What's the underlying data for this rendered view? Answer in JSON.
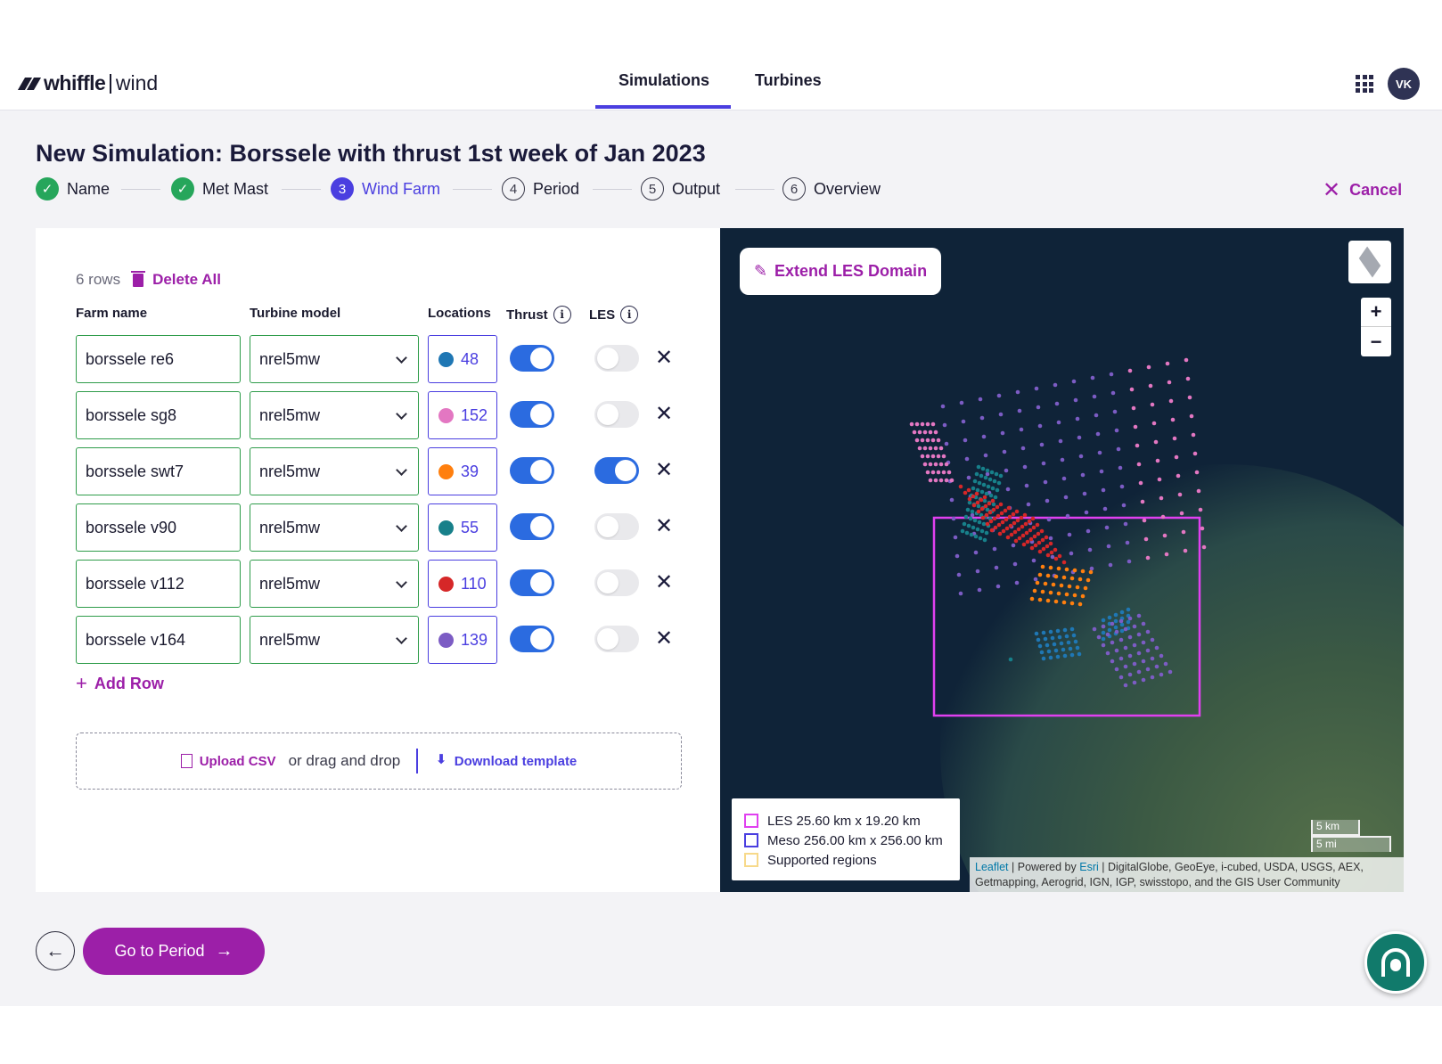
{
  "header": {
    "brand": "whiffle",
    "brand_sub": "wind",
    "tabs": [
      {
        "label": "Simulations",
        "active": true
      },
      {
        "label": "Turbines",
        "active": false
      }
    ],
    "apps_icon": "apps-grid-icon",
    "avatar_initials": "VK"
  },
  "page_title": "New Simulation: Borssele with thrust 1st week of Jan 2023",
  "stepper": [
    {
      "num": "✓",
      "label": "Name",
      "state": "done"
    },
    {
      "num": "✓",
      "label": "Met Mast",
      "state": "done"
    },
    {
      "num": "3",
      "label": "Wind Farm",
      "state": "current"
    },
    {
      "num": "4",
      "label": "Period",
      "state": "todo"
    },
    {
      "num": "5",
      "label": "Output",
      "state": "todo"
    },
    {
      "num": "6",
      "label": "Overview",
      "state": "todo"
    }
  ],
  "cancel_label": "Cancel",
  "table": {
    "row_count": "6 rows",
    "delete_all": "Delete All",
    "columns": {
      "farm": "Farm name",
      "model": "Turbine model",
      "locations": "Locations",
      "thrust": "Thrust",
      "les": "LES"
    },
    "rows": [
      {
        "name": "borssele re6",
        "model": "nrel5mw",
        "locations": "48",
        "color": "#1f77b4",
        "thrust": true,
        "les": false
      },
      {
        "name": "borssele sg8",
        "model": "nrel5mw",
        "locations": "152",
        "color": "#e377c2",
        "thrust": true,
        "les": false
      },
      {
        "name": "borssele swt7",
        "model": "nrel5mw",
        "locations": "39",
        "color": "#ff7f0e",
        "thrust": true,
        "les": true
      },
      {
        "name": "borssele v90",
        "model": "nrel5mw",
        "locations": "55",
        "color": "#17808a",
        "thrust": true,
        "les": false
      },
      {
        "name": "borssele v112",
        "model": "nrel5mw",
        "locations": "110",
        "color": "#d62728",
        "thrust": true,
        "les": false
      },
      {
        "name": "borssele v164",
        "model": "nrel5mw",
        "locations": "139",
        "color": "#7c5cc4",
        "thrust": true,
        "les": false
      }
    ],
    "add_row": "Add Row",
    "upload_csv": "Upload CSV",
    "drag_drop": "or drag and drop",
    "download_template": "Download template"
  },
  "map": {
    "extend_les": "Extend LES Domain",
    "zoom_in": "+",
    "zoom_out": "−",
    "legend": [
      {
        "label": "LES 25.60 km x 19.20 km",
        "color": "#e040f0"
      },
      {
        "label": "Meso 256.00 km x 256.00 km",
        "color": "#4a3ee0"
      },
      {
        "label": "Supported regions",
        "color": "#f7d98a"
      }
    ],
    "scale_km": "5 km",
    "scale_mi": "5 mi",
    "attribution_leaflet": "Leaflet",
    "attribution_powered": "| Powered by",
    "attribution_esri": "Esri",
    "attribution_rest": "| DigitalGlobe, GeoEye, i-cubed, USDA, USGS, AEX, Getmapping, Aerogrid, IGN, IGP, swisstopo, and the GIS User Community"
  },
  "footer": {
    "go_label": "Go to Period"
  }
}
